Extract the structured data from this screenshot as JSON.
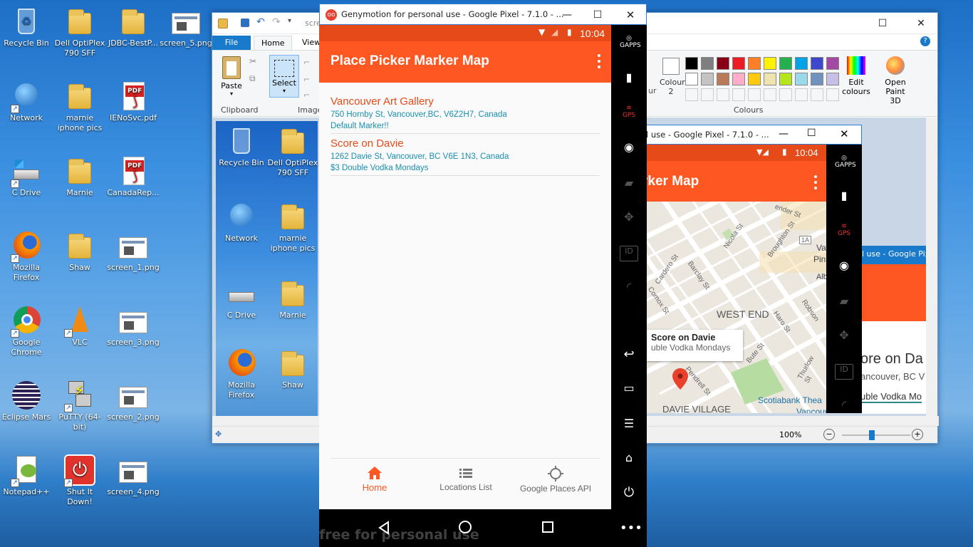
{
  "desktop": {
    "icons": [
      {
        "label": "Recycle Bin",
        "icon": "recycle-bin-icon"
      },
      {
        "label": "Dell OptiPlex 790 SFF",
        "icon": "folder-icon"
      },
      {
        "label": "JDBC-BestP...",
        "icon": "folder-icon"
      },
      {
        "label": "screen_5.png",
        "icon": "image-icon"
      },
      {
        "label": "Network",
        "icon": "network-icon"
      },
      {
        "label": "marnie iphone pics",
        "icon": "folder-icon"
      },
      {
        "label": "IENoSvc.pdf",
        "icon": "pdf-icon"
      },
      {
        "label": "C Drive",
        "icon": "drive-icon"
      },
      {
        "label": "Marnie",
        "icon": "folder-icon"
      },
      {
        "label": "CanadaRep...",
        "icon": "pdf-icon"
      },
      {
        "label": "Mozilla Firefox",
        "icon": "firefox-icon"
      },
      {
        "label": "Shaw",
        "icon": "folder-icon"
      },
      {
        "label": "screen_1.png",
        "icon": "image-icon"
      },
      {
        "label": "Google Chrome",
        "icon": "chrome-icon"
      },
      {
        "label": "VLC",
        "icon": "vlc-icon"
      },
      {
        "label": "screen_3.png",
        "icon": "image-icon"
      },
      {
        "label": "Eclipse Mars",
        "icon": "eclipse-icon"
      },
      {
        "label": "PuTTY (64-bit)",
        "icon": "putty-icon"
      },
      {
        "label": "screen_2.png",
        "icon": "image-icon"
      },
      {
        "label": "Notepad++",
        "icon": "notepad-icon"
      },
      {
        "label": "Shut It Down!",
        "icon": "power-icon"
      },
      {
        "label": "screen_4.png",
        "icon": "image-icon"
      }
    ]
  },
  "paint": {
    "title_partial": "scre",
    "tabs": [
      "File",
      "Home",
      "View"
    ],
    "paste_label": "Paste",
    "select_label": "Select",
    "clipboard_label": "Clipboard",
    "image_label": "Image",
    "colour2_label": "Colour 2",
    "colours_label": "Colours",
    "edit_colours_label": "Edit colours",
    "open3d_label": "Open Paint 3D",
    "zoom": "100%",
    "size_label": "ur",
    "palette": [
      "#000000",
      "#7f7f7f",
      "#880015",
      "#ed1c24",
      "#ff7f27",
      "#fff200",
      "#22b14c",
      "#00a2e8",
      "#3f48cc",
      "#a349a4",
      "#ffffff",
      "#c3c3c3",
      "#b97a57",
      "#ffaec9",
      "#ffc90e",
      "#efe4b0",
      "#b5e61d",
      "#99d9ea",
      "#7092be",
      "#c8bfe7"
    ],
    "inner_desktop": [
      {
        "label": "Recycle Bin"
      },
      {
        "label": "Dell OptiPlex 790 SFF"
      },
      {
        "label": "Network"
      },
      {
        "label": "marnie iphone pics"
      },
      {
        "label": "C Drive"
      },
      {
        "label": "Marnie"
      },
      {
        "label": "Mozilla Firefox"
      },
      {
        "label": "Shaw"
      }
    ]
  },
  "geny": {
    "title": "Genymotion for personal use - Google Pixel - 7.1.0 - ...",
    "time": "10:04",
    "app_title": "Place Picker Marker Map",
    "locations": [
      {
        "name": "Vancouver Art Gallery",
        "address": "750 Hornby St, Vancouver,BC, V6Z2H7, Canada",
        "desc": "Default Marker!!"
      },
      {
        "name": "Score on Davie",
        "address": "1262 Davie St, Vancouver, BC V6E 1N3, Canada",
        "desc": "$3 Double Vodka Mondays"
      }
    ],
    "nav": [
      {
        "label": "Home",
        "icon": "home-icon"
      },
      {
        "label": "Locations List",
        "icon": "list-icon"
      },
      {
        "label": "Google Places API",
        "icon": "crosshair-icon"
      }
    ],
    "side_labels": {
      "gapps": "GAPPS",
      "gps": "GPS",
      "id": "ID"
    },
    "watermark": "free for personal use"
  },
  "geny2": {
    "title_partial": "l use - Google Pixel - 7.1.0 - ...",
    "time": "10:04",
    "app_title_partial": "rker Map",
    "info_title": "Score on Davie",
    "info_desc": "uble Vodka Mondays",
    "map_labels": {
      "west_end": "WEST END",
      "davie_village": "DAVIE VILLAGE",
      "scotiabank": "Scotiabank Thea",
      "vancouv": "Vancouv",
      "nicola": "Nicola St",
      "broughton": "Broughton St",
      "cardero": "Cardero St",
      "barclay": "Barclay St",
      "comox": "Comox St",
      "haro": "Haro St",
      "robson": "Robson",
      "bute": "Bute St",
      "pendrell": "Pendrell St",
      "thurlow": "Thurlow St",
      "bender": "ender St",
      "hwy": "1A",
      "va": "Va",
      "pin": "Pin",
      "alb": "Alb"
    },
    "right_peek": {
      "title": "l use - Google Pix",
      "name": "ore on Da",
      "addr": "ancouver, BC V",
      "desc": "uble Vodka Mo"
    }
  }
}
